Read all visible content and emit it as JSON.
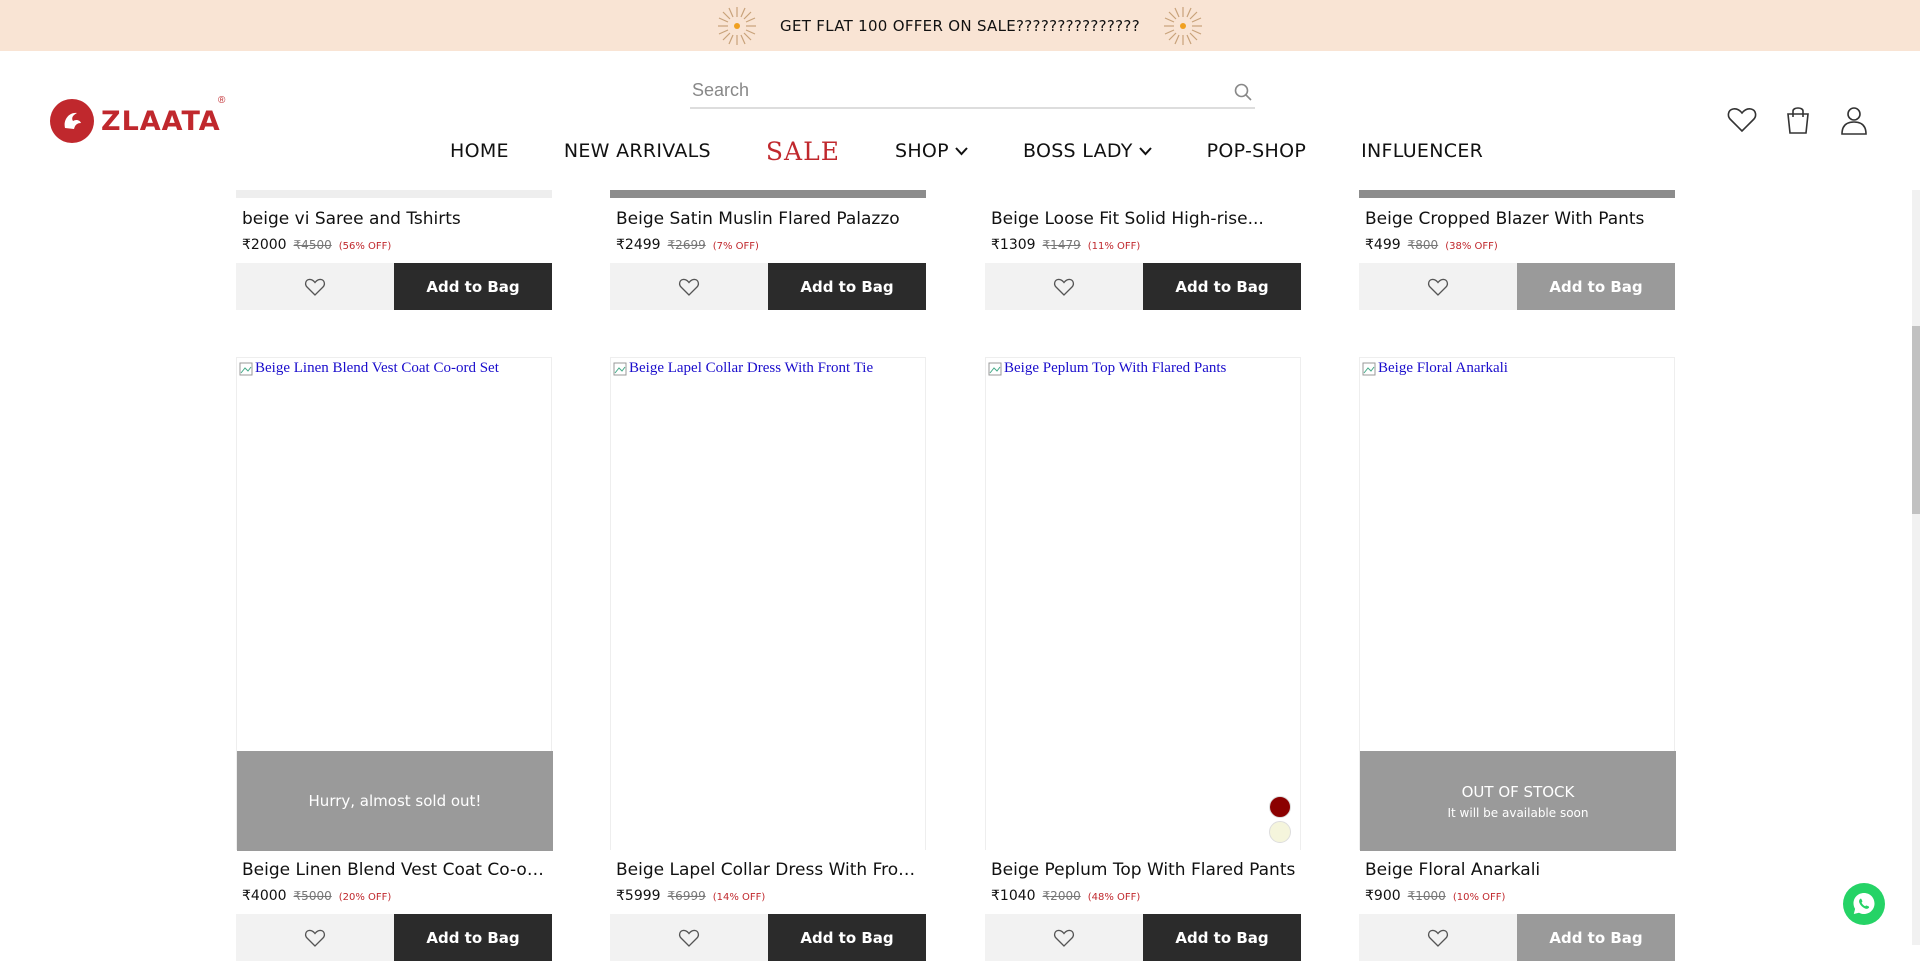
{
  "announcement": {
    "text": "GET FLAT 100 OFFER ON SALE???????????????"
  },
  "header": {
    "logo_text": "ZLAATA",
    "logo_reg": "®",
    "search_placeholder": "Search",
    "nav": [
      {
        "label": "HOME"
      },
      {
        "label": "NEW ARRIVALS"
      },
      {
        "label": "SALE"
      },
      {
        "label": "SHOP"
      },
      {
        "label": "BOSS LADY"
      },
      {
        "label": "POP-SHOP"
      },
      {
        "label": "INFLUENCER"
      }
    ]
  },
  "row1": [
    {
      "name": "beige vi Saree and Tshirts",
      "price": "₹2000",
      "mrp": "₹4500",
      "off": "(56% OFF)",
      "add_label": "Add to Bag"
    },
    {
      "name": "Beige Satin Muslin Flared Palazzo",
      "price": "₹2499",
      "mrp": "₹2699",
      "off": "(7% OFF)",
      "add_label": "Add to Bag"
    },
    {
      "name": "Beige Loose Fit Solid High-rise...",
      "price": "₹1309",
      "mrp": "₹1479",
      "off": "(11% OFF)",
      "add_label": "Add to Bag"
    },
    {
      "name": "Beige Cropped Blazer With Pants",
      "price": "₹499",
      "mrp": "₹800",
      "off": "(38% OFF)",
      "add_label": "Add to Bag"
    }
  ],
  "row2": [
    {
      "alt": "Beige Linen Blend Vest Coat Co-ord Set",
      "overlay": "Hurry, almost sold out!",
      "name": "Beige Linen Blend Vest Coat Co-ord...",
      "price": "₹4000",
      "mrp": "₹5000",
      "off": "(20% OFF)",
      "add_label": "Add to Bag"
    },
    {
      "alt": "Beige Lapel Collar Dress With Front Tie",
      "name": "Beige Lapel Collar Dress With Front...",
      "price": "₹5999",
      "mrp": "₹6999",
      "off": "(14% OFF)",
      "add_label": "Add to Bag"
    },
    {
      "alt": "Beige Peplum Top With Flared Pants",
      "name": "Beige Peplum Top With Flared Pants",
      "price": "₹1040",
      "mrp": "₹2000",
      "off": "(48% OFF)",
      "add_label": "Add to Bag",
      "swatches": [
        "#8b0000",
        "#f5f5dc"
      ]
    },
    {
      "alt": "Beige Floral Anarkali",
      "overlay": "OUT OF STOCK",
      "overlay_sub": "It will be available soon",
      "name": "Beige Floral Anarkali",
      "price": "₹900",
      "mrp": "₹1000",
      "off": "(10% OFF)",
      "add_label": "Add to Bag"
    }
  ],
  "colors": {
    "brand": "#c0282d",
    "announce_bg": "#f9e4d4",
    "button_dark": "#2b2b2b",
    "button_disabled": "#9a9a9a"
  }
}
